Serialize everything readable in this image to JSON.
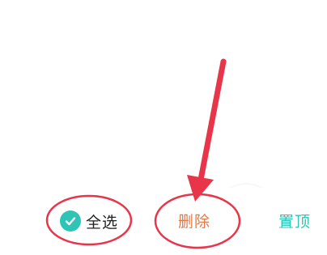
{
  "toolbar": {
    "select_all_label": "全选",
    "select_all_checked": true,
    "delete_label": "删除",
    "pin_label": "置顶"
  },
  "icons": {
    "select_all": "check-circle-icon"
  },
  "colors": {
    "accent_teal": "#2ec4b6",
    "delete_orange": "#e07a4a",
    "annotation_red": "#e8354a",
    "text_dark": "#222222"
  }
}
